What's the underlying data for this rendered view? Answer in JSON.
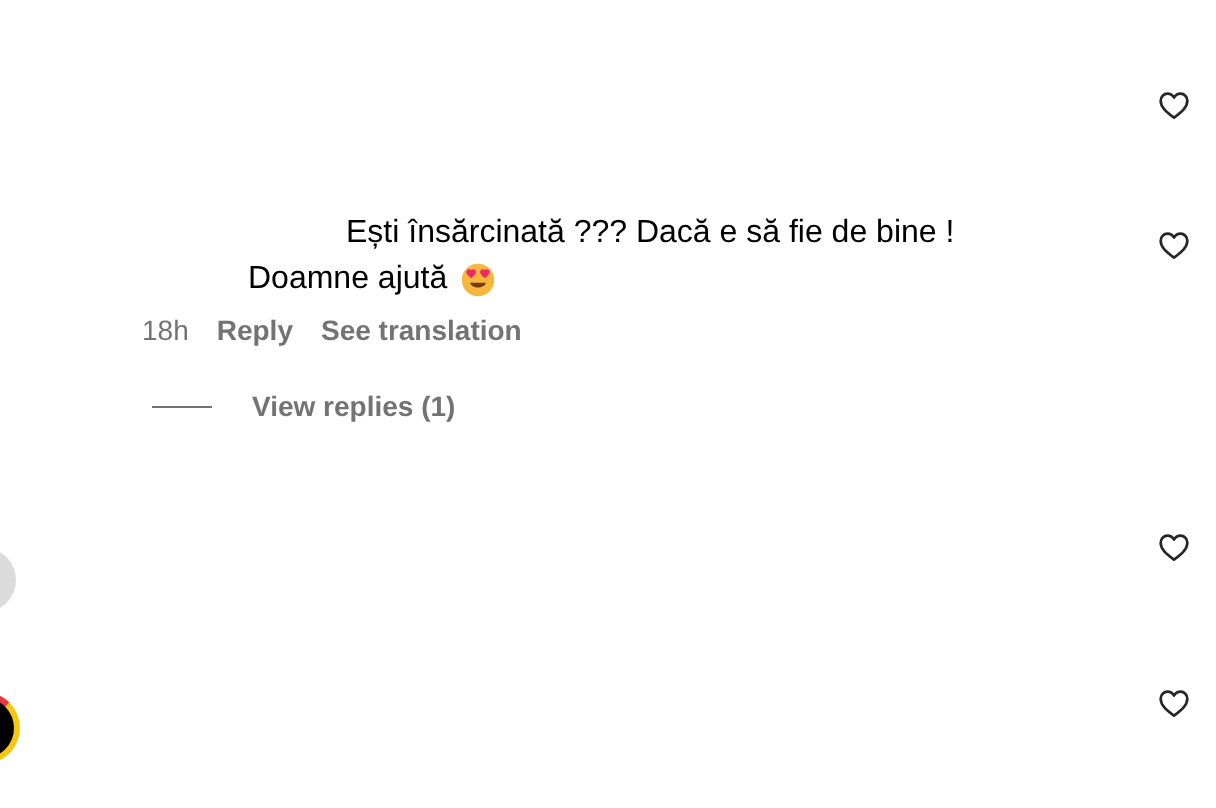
{
  "comments": [
    {
      "liked": false
    },
    {
      "text": "Ești însărcinată ??? Dacă e să fie de bine !",
      "text_2": "Doamne ajută",
      "time": "18h",
      "reply": "Reply",
      "translate": "See translation",
      "view_replies": "View replies (1)",
      "liked": false
    },
    {
      "kind": "plain",
      "liked": false
    },
    {
      "kind": "story",
      "liked": false
    }
  ]
}
